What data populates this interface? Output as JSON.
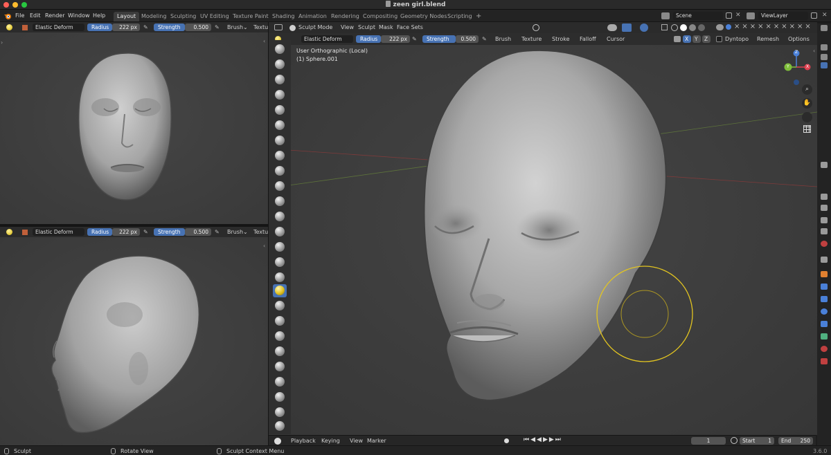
{
  "window": {
    "title": "zeen girl.blend"
  },
  "menu": {
    "items": [
      "File",
      "Edit",
      "Render",
      "Window",
      "Help"
    ],
    "workspaces": [
      "Layout",
      "Modeling",
      "Sculpting",
      "UV Editing",
      "Texture Paint",
      "Shading",
      "Animation",
      "Rendering",
      "Compositing",
      "Geometry Nodes",
      "Scripting"
    ],
    "active_workspace": "Layout",
    "add_workspace": "+",
    "scene": "Scene",
    "view_layer": "ViewLayer"
  },
  "tool_settings": {
    "brush_name": "Elastic Deform",
    "radius_label": "Radius",
    "radius_value": "222 px",
    "strength_label": "Strength",
    "strength_value": "0.500",
    "brush_menu": "Brush",
    "texture_menu": "Texture",
    "texture_menu_clipped": "Textu",
    "stroke_menu": "Stroke",
    "falloff_menu": "Falloff",
    "cursor_menu": "Cursor",
    "dyntopo": "Dyntopo",
    "remesh": "Remesh",
    "options": "Options",
    "axes": [
      "X",
      "Y",
      "Z"
    ]
  },
  "main_viewport": {
    "mode": "Sculpt Mode",
    "menus": [
      "View",
      "Sculpt",
      "Mask",
      "Face Sets"
    ],
    "view_name": "User Orthographic (Local)",
    "object_name": "(1) Sphere.001",
    "gizmo_axes": [
      "X",
      "Y",
      "Z"
    ]
  },
  "timeline": {
    "menus": [
      "Playback",
      "Keying",
      "View",
      "Marker"
    ],
    "current_frame": "1",
    "start_label": "Start",
    "start": "1",
    "end_label": "End",
    "end": "250"
  },
  "statusbar": {
    "left": "Sculpt",
    "middle": "Rotate View",
    "right": "Sculpt Context Menu",
    "version": "3.6.0"
  },
  "colors": {
    "accent": "#4772b3",
    "brush_circle": "#e3c520",
    "viewport_bg": "#3d3d3d",
    "axis_x": "#e04050",
    "axis_y": "#7fbf3a",
    "axis_z": "#4a80d8"
  },
  "icons": [
    "blender-logo-icon",
    "sculpt-brush-icon",
    "pen-pressure-icon",
    "gizmo-zoom-icon",
    "gizmo-pan-icon",
    "camera-icon",
    "grid-icon",
    "play-icon",
    "timer-icon",
    "mouse-icon"
  ]
}
